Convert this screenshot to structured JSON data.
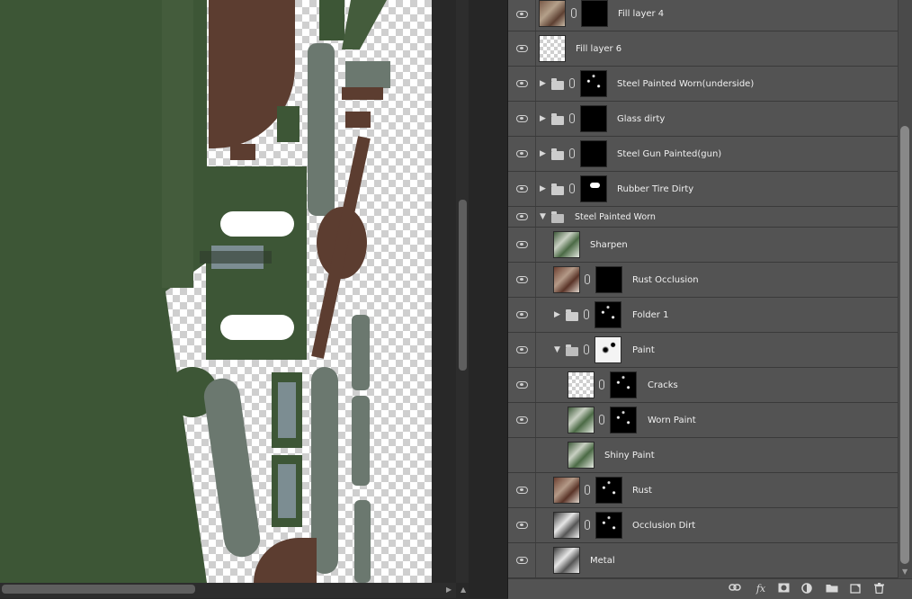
{
  "layers_panel": {
    "layers": [
      {
        "name": "Fill layer 4"
      },
      {
        "name": "Fill layer 6"
      },
      {
        "name": "Steel Painted Worn(underside)"
      },
      {
        "name": "Glass dirty"
      },
      {
        "name": "Steel Gun Painted(gun)"
      },
      {
        "name": "Rubber Tire Dirty"
      },
      {
        "name": "Steel Painted Worn"
      },
      {
        "name": "Sharpen"
      },
      {
        "name": "Rust Occlusion"
      },
      {
        "name": "Folder 1"
      },
      {
        "name": "Paint"
      },
      {
        "name": "Cracks"
      },
      {
        "name": "Worn Paint"
      },
      {
        "name": "Shiny Paint"
      },
      {
        "name": "Rust"
      },
      {
        "name": "Occlusion Dirt"
      },
      {
        "name": "Metal"
      }
    ],
    "footer": {
      "link_icon": "link-icon",
      "fx_label": "fx",
      "mask_icon": "add-mask-icon",
      "adjustment_icon": "adjustment-layer-icon",
      "folder_icon": "new-group-icon",
      "new_layer_icon": "new-layer-icon",
      "delete_icon": "trash-icon"
    }
  },
  "colors": {
    "panel_bg": "#535353",
    "canvas_bg": "#282828",
    "texture_green": "#3d5636",
    "texture_rust": "#5c3d30"
  }
}
